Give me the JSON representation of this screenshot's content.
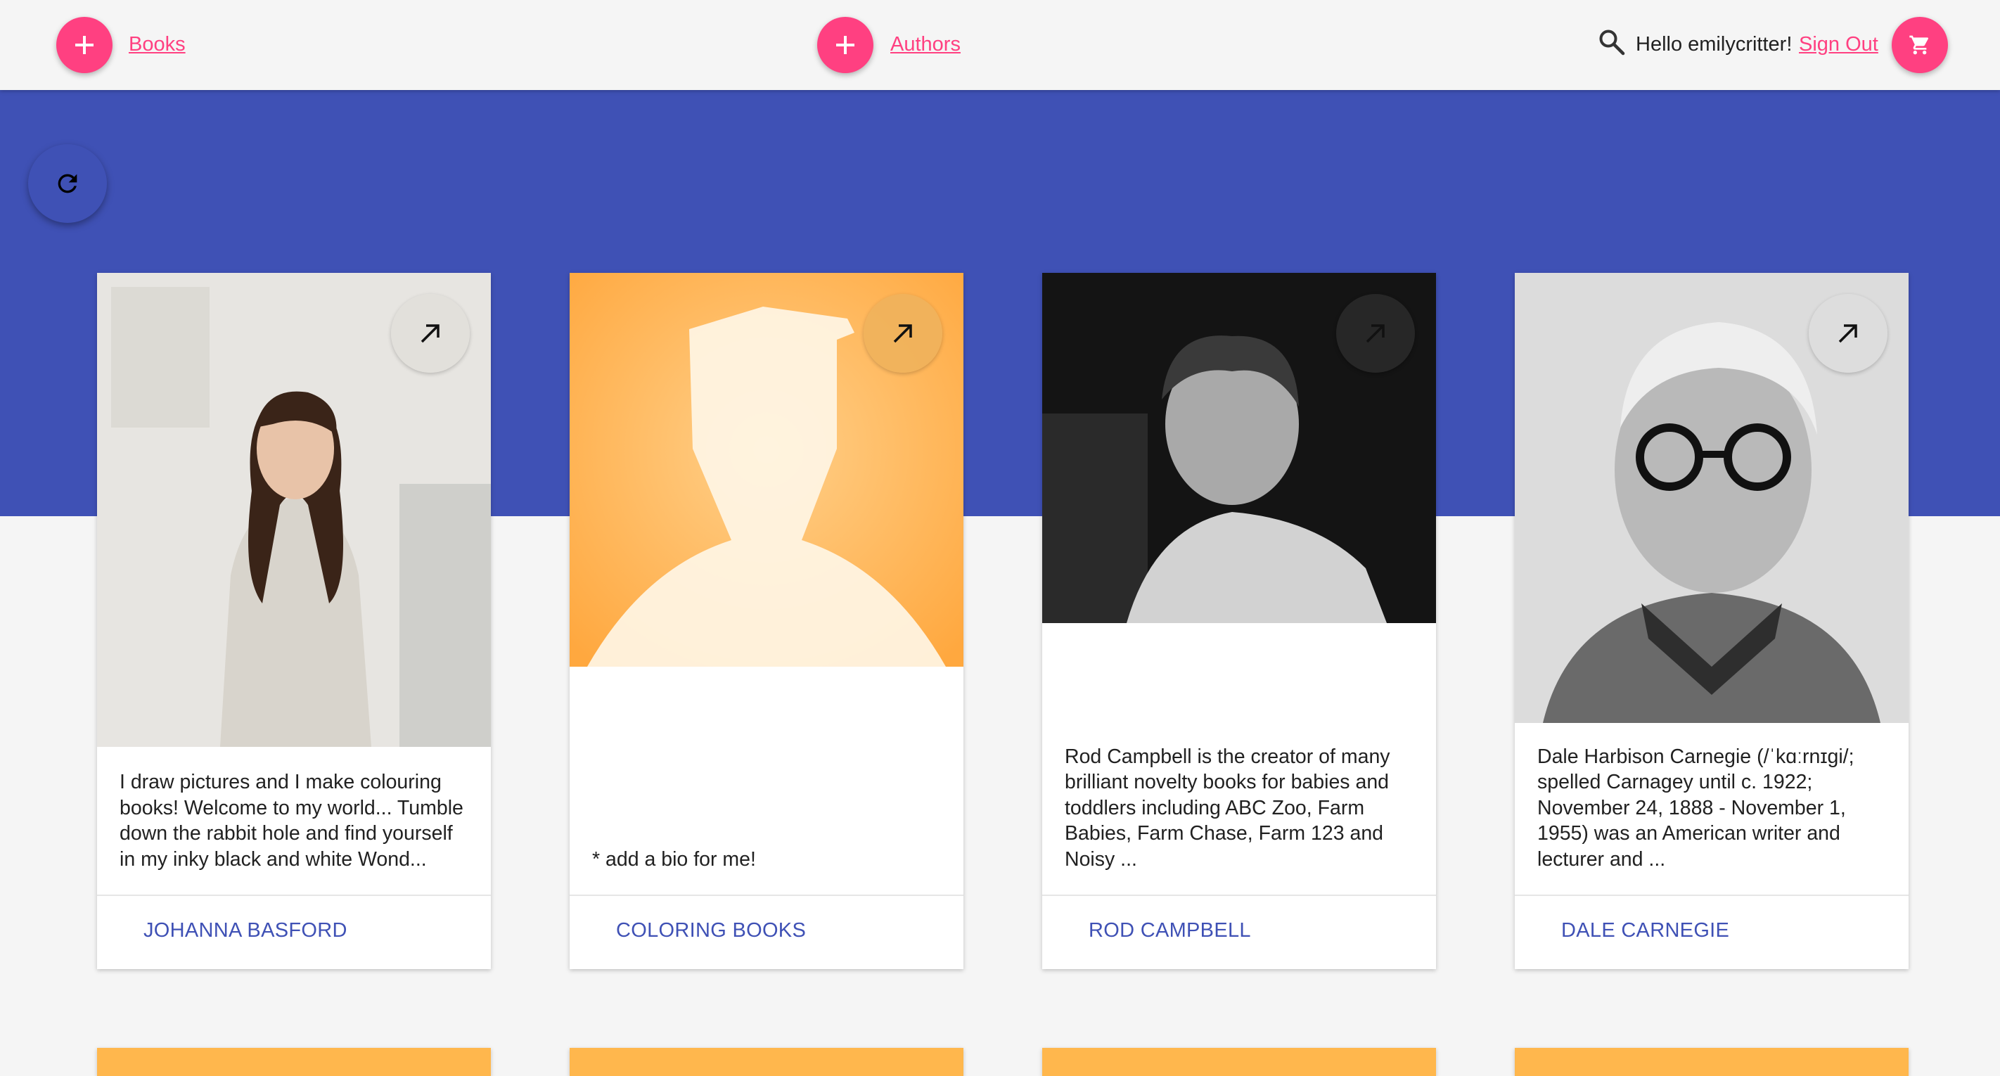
{
  "header": {
    "books_link": "Books",
    "authors_link": "Authors",
    "greeting": "Hello emilycritter!",
    "sign_out": "Sign Out",
    "icons": {
      "add_books": "plus-icon",
      "add_authors": "plus-icon",
      "search": "search-icon",
      "cart": "cart-icon"
    },
    "accent_color": "#ff4081"
  },
  "banner": {
    "color": "#3f51b5",
    "refresh_icon": "refresh-icon"
  },
  "authors": [
    {
      "name": "JOHANNA BASFORD",
      "bio": "I draw pictures and I make colouring books! Welcome to my world... Tumble down the rabbit hole and find yourself in my inky black and white Wond...",
      "photo": "portrait-photo"
    },
    {
      "name": "COLORING BOOKS",
      "bio": "* add a bio for me!",
      "photo": "placeholder-silhouette"
    },
    {
      "name": "ROD CAMPBELL",
      "bio": "Rod Campbell is the creator of many brilliant novelty books for babies and toddlers including ABC Zoo, Farm Babies, Farm Chase, Farm 123 and Noisy ...",
      "photo": "portrait-photo"
    },
    {
      "name": "DALE CARNEGIE",
      "bio": "Dale Harbison Carnegie (/ˈkɑːrnɪɡi/; spelled Carnagey until c. 1922; November 24, 1888 - November 1, 1955) was an American writer and lecturer and ...",
      "photo": "portrait-photo"
    }
  ],
  "open_icon": "arrow-up-right-icon"
}
